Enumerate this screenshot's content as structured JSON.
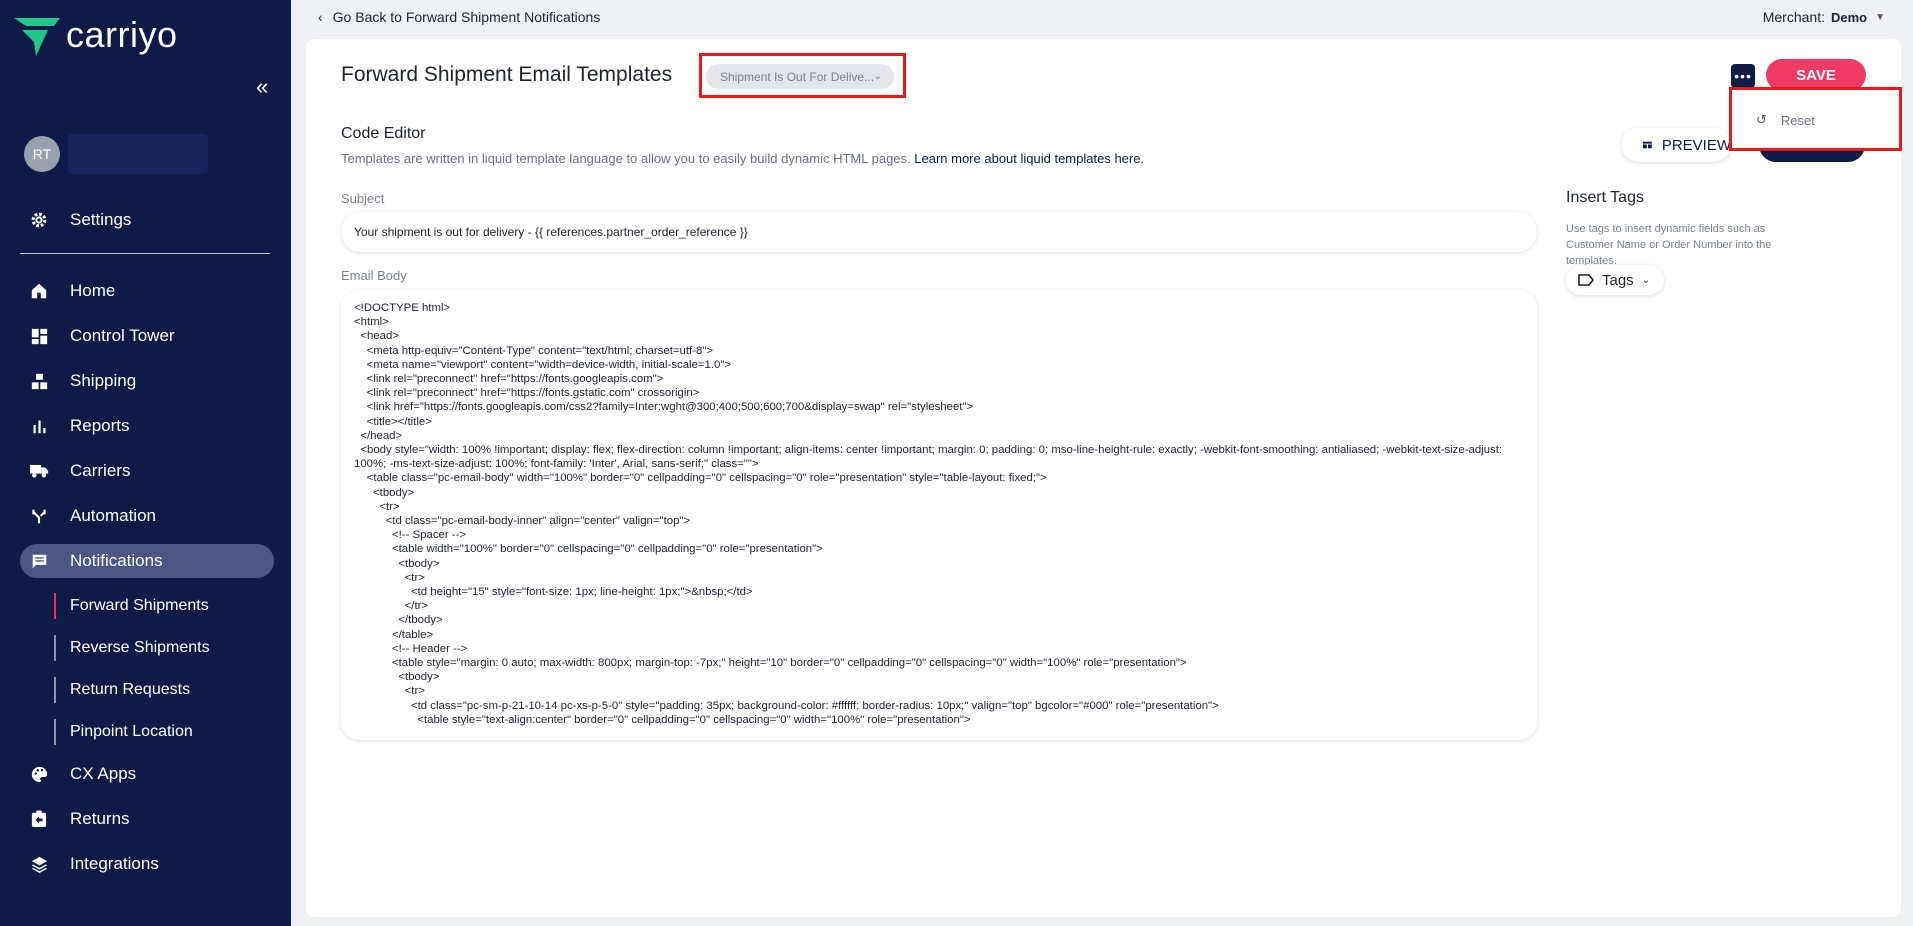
{
  "brand": {
    "name": "carriyo"
  },
  "user": {
    "initials": "RT"
  },
  "sidebar": {
    "settings_label": "Settings",
    "items": [
      {
        "label": "Home",
        "icon": "home-icon"
      },
      {
        "label": "Control Tower",
        "icon": "dashboard-icon"
      },
      {
        "label": "Shipping",
        "icon": "shipping-icon"
      },
      {
        "label": "Reports",
        "icon": "reports-icon"
      },
      {
        "label": "Carriers",
        "icon": "truck-icon"
      },
      {
        "label": "Automation",
        "icon": "automation-icon"
      },
      {
        "label": "Notifications",
        "icon": "message-icon"
      }
    ],
    "sub_items": [
      {
        "label": "Forward Shipments"
      },
      {
        "label": "Reverse Shipments"
      },
      {
        "label": "Return Requests"
      },
      {
        "label": "Pinpoint Location"
      }
    ],
    "bottom_items": [
      {
        "label": "CX Apps",
        "icon": "palette-icon"
      },
      {
        "label": "Returns",
        "icon": "returns-icon"
      },
      {
        "label": "Integrations",
        "icon": "layers-icon"
      }
    ]
  },
  "topbar": {
    "back_label": "Go Back to Forward Shipment Notifications",
    "merchant_label": "Merchant:",
    "merchant_value": "Demo"
  },
  "header": {
    "title": "Forward Shipment Email Templates",
    "status_chip": "Shipment Is Out For Delive...",
    "save_label": "SAVE",
    "more_label": "•••"
  },
  "menu": {
    "reset_label": "Reset"
  },
  "editor": {
    "title": "Code Editor",
    "description": "Templates are written in liquid template language to allow you to easily build dynamic HTML pages. ",
    "link_text": "Learn more about liquid templates here.",
    "preview_label": "PREVIEW",
    "subject_label": "Subject",
    "subject_value": "Your shipment is out for delivery - {{ references.partner_order_reference }}",
    "body_label": "Email Body",
    "body_value": "<!DOCTYPE html>\n<html>\n  <head>\n    <meta http-equiv=\"Content-Type\" content=\"text/html; charset=utf-8\">\n    <meta name=\"viewport\" content=\"width=device-width, initial-scale=1.0\">\n    <link rel=\"preconnect\" href=\"https://fonts.googleapis.com\">\n    <link rel=\"preconnect\" href=\"https://fonts.gstatic.com\" crossorigin>\n    <link href=\"https://fonts.googleapis.com/css2?family=Inter:wght@300;400;500;600;700&display=swap\" rel=\"stylesheet\">\n    <title></title>\n  </head>\n  <body style=\"width: 100% !important; display: flex; flex-direction: column !important; align-items: center !important; margin: 0; padding: 0; mso-line-height-rule: exactly; -webkit-font-smoothing: antialiased; -webkit-text-size-adjust: 100%; -ms-text-size-adjust: 100%; font-family: 'Inter', Arial, sans-serif;\" class=\"\">\n    <table class=\"pc-email-body\" width=\"100%\" border=\"0\" cellpadding=\"0\" cellspacing=\"0\" role=\"presentation\" style=\"table-layout: fixed;\">\n      <tbody>\n        <tr>\n          <td class=\"pc-email-body-inner\" align=\"center\" valign=\"top\">\n            <!-- Spacer -->\n            <table width=\"100%\" border=\"0\" cellspacing=\"0\" cellpadding=\"0\" role=\"presentation\">\n              <tbody>\n                <tr>\n                  <td height=\"15\" style=\"font-size: 1px; line-height: 1px;\">&nbsp;</td>\n                </tr>\n              </tbody>\n            </table>\n            <!-- Header -->\n            <table style=\"margin: 0 auto; max-width: 800px; margin-top: -7px;\" height=\"10\" border=\"0\" cellpadding=\"0\" cellspacing=\"0\" width=\"100%\" role=\"presentation\">\n              <tbody>\n                <tr>\n                  <td class=\"pc-sm-p-21-10-14 pc-xs-p-5-0\" style=\"padding: 35px; background-color: #ffffff; border-radius: 10px;\" valign=\"top\" bgcolor=\"#000\" role=\"presentation\">\n                    <table style=\"text-align:center\" border=\"0\" cellpadding=\"0\" cellspacing=\"0\" width=\"100%\" role=\"presentation\">"
  },
  "tags": {
    "title": "Insert Tags",
    "description": "Use tags to insert dynamic fields such as Customer Name or Order Number into the templates.",
    "button_label": "Tags"
  },
  "colors": {
    "sidebar_bg": "#0e1b47",
    "accent": "#ef3b64",
    "highlight_border": "#e31b1b"
  }
}
